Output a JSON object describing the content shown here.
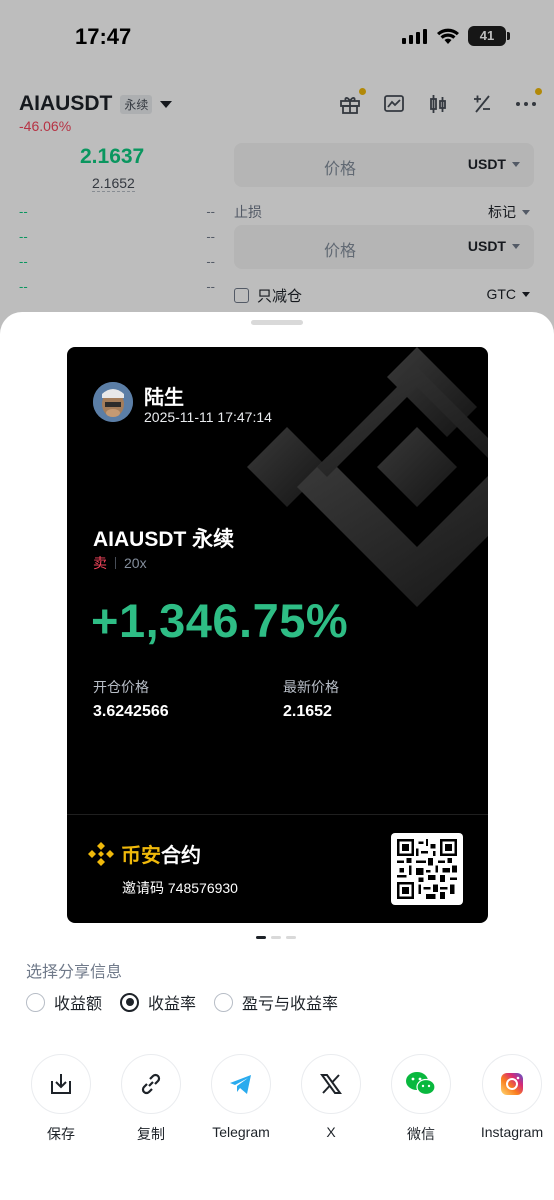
{
  "status_bar": {
    "time": "17:47",
    "battery": "41"
  },
  "background": {
    "symbol": "AIAUSDT",
    "contract_type": "永续",
    "change": "-46.06%",
    "last_price": "2.1637",
    "mark_price": "2.1652",
    "orderbook_rows": [
      {
        "left": "--",
        "right": "--"
      },
      {
        "left": "--",
        "right": "--"
      },
      {
        "left": "--",
        "right": "--"
      },
      {
        "left": "--",
        "right": "--"
      }
    ],
    "price_field": {
      "placeholder": "价格",
      "unit": "USDT"
    },
    "stop_loss_label": "止损",
    "mark_label": "标记",
    "sl_price_field": {
      "placeholder": "价格",
      "unit": "USDT"
    },
    "reduce_only": "只减仓",
    "tif": "GTC"
  },
  "card": {
    "username": "陆生",
    "datetime": "2025-11-11 17:47:14",
    "symbol": "AIAUSDT 永续",
    "side": "卖",
    "leverage": "20x",
    "roi": "+1,346.75%",
    "open_price_label": "开仓价格",
    "open_price": "3.6242566",
    "last_price_label": "最新价格",
    "last_price": "2.1652",
    "brand_prefix": "币安",
    "brand_suffix": "合约",
    "invite_code": "邀请码 748576930",
    "colors": {
      "roi": "#2ebd85",
      "side": "#f6465d",
      "brand": "#f0b90b"
    }
  },
  "share_info": {
    "title": "选择分享信息",
    "options": [
      {
        "label": "收益额",
        "selected": false
      },
      {
        "label": "收益率",
        "selected": true
      },
      {
        "label": "盈亏与收益率",
        "selected": false
      }
    ]
  },
  "share_targets": [
    {
      "label": "保存",
      "icon": "download-icon"
    },
    {
      "label": "复制",
      "icon": "link-icon"
    },
    {
      "label": "Telegram",
      "icon": "telegram-icon"
    },
    {
      "label": "X",
      "icon": "x-logo-icon"
    },
    {
      "label": "微信",
      "icon": "wechat-icon"
    },
    {
      "label": "Instagram",
      "icon": "instagram-icon"
    }
  ]
}
